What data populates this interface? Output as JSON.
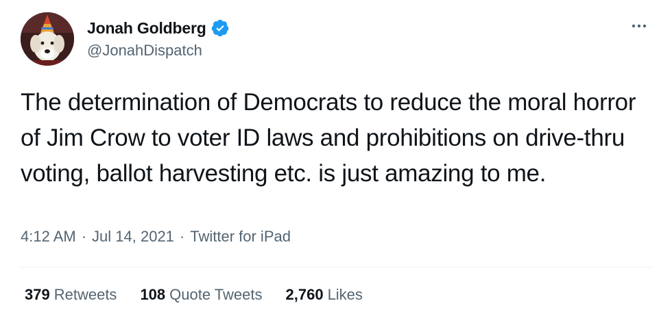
{
  "user": {
    "display_name": "Jonah Goldberg",
    "handle": "@JonahDispatch",
    "verified": true
  },
  "tweet": {
    "text": "The determination of Democrats to reduce the moral horror of Jim Crow to voter ID laws and prohibitions on drive-thru voting, ballot harvesting etc. is just amazing to me.",
    "time": "4:12 AM",
    "separator": "·",
    "date": "Jul 14, 2021",
    "source": "Twitter for iPad"
  },
  "stats": [
    {
      "count": "379",
      "label": "Retweets"
    },
    {
      "count": "108",
      "label": "Quote Tweets"
    },
    {
      "count": "2,760",
      "label": "Likes"
    }
  ],
  "icons": {
    "verified": "verified-badge-icon",
    "more": "more-options-icon"
  },
  "colors": {
    "text_primary": "#0f1419",
    "text_secondary": "#536471",
    "verified_blue": "#1d9bf0",
    "divider": "#eff3f4"
  }
}
